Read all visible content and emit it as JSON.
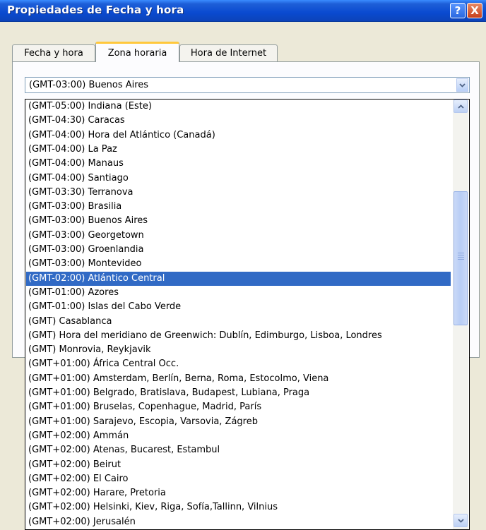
{
  "window": {
    "title": "Propiedades de Fecha y hora",
    "help_glyph": "?",
    "close_glyph": "X"
  },
  "tabs": [
    {
      "label": "Fecha y hora"
    },
    {
      "label": "Zona horaria",
      "active": true
    },
    {
      "label": "Hora de Internet"
    }
  ],
  "timezone_select": {
    "selected_value": "(GMT-03:00) Buenos Aires",
    "options": [
      "(GMT-05:00) Indiana (Este)",
      "(GMT-04:30) Caracas",
      "(GMT-04:00) Hora del Atlántico (Canadá)",
      "(GMT-04:00) La Paz",
      "(GMT-04:00) Manaus",
      "(GMT-04:00) Santiago",
      "(GMT-03:30) Terranova",
      "(GMT-03:00) Brasilia",
      "(GMT-03:00) Buenos Aires",
      "(GMT-03:00) Georgetown",
      "(GMT-03:00) Groenlandia",
      "(GMT-03:00) Montevideo",
      "(GMT-02:00) Atlántico Central",
      "(GMT-01:00) Azores",
      "(GMT-01:00) Islas del Cabo Verde",
      "(GMT) Casablanca",
      "(GMT) Hora del meridiano de Greenwich: Dublín, Edimburgo, Lisboa, Londres",
      "(GMT) Monrovia, Reykjavik",
      "(GMT+01:00) África Central Occ.",
      "(GMT+01:00) Amsterdam, Berlín, Berna, Roma, Estocolmo, Viena",
      "(GMT+01:00) Belgrado, Bratislava, Budapest, Lubiana, Praga",
      "(GMT+01:00) Bruselas, Copenhague, Madrid, París",
      "(GMT+01:00) Sarajevo, Escopia, Varsovia, Zágreb",
      "(GMT+02:00) Ammán",
      "(GMT+02:00) Atenas, Bucarest, Estambul",
      "(GMT+02:00) Beirut",
      "(GMT+02:00) El Cairo",
      "(GMT+02:00) Harare, Pretoria",
      "(GMT+02:00) Helsinki, Kiev, Riga, Sofía,Tallinn, Vilnius",
      "(GMT+02:00) Jerusalén"
    ],
    "highlighted_index": 12
  },
  "colors": {
    "selection": "#316ac5",
    "titlebar": "#0a4ad0",
    "active_tab_accent": "#ffc83c"
  }
}
